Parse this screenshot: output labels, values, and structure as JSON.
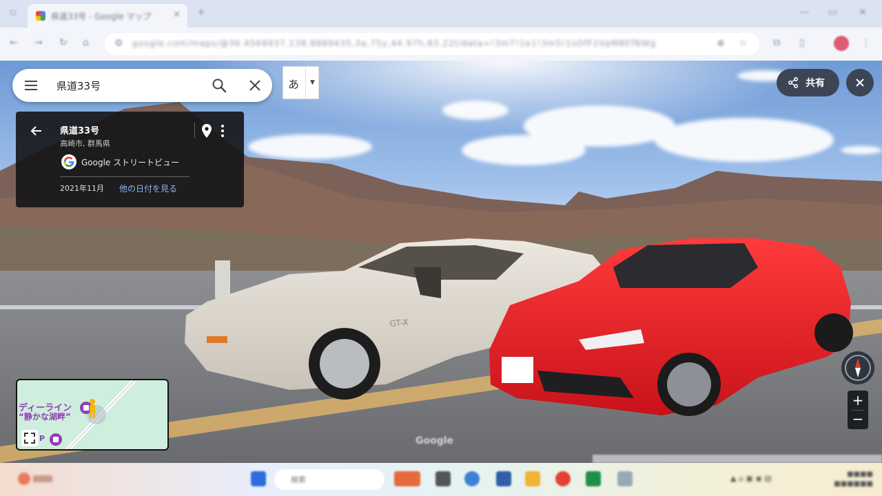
{
  "browser": {
    "tab_title": "県道33号 - Google マップ",
    "url": "google.com/maps/@36.4568937,138.8889435,3a,75y,44.97h,83.22t/data=!3m7!1e1!3m5!1sOfF2VpM8EfNWg"
  },
  "search": {
    "query": "県道33号"
  },
  "ime": {
    "mode_char": "あ"
  },
  "share": {
    "label": "共有"
  },
  "info_card": {
    "title": "県道33号",
    "subtitle": "高崎市, 群馬県",
    "provider": "Google ストリートビュー",
    "capture_date": "2021年11月",
    "other_dates_link": "他の日付を見る"
  },
  "minimap": {
    "place_line1": "ディーライン",
    "place_line2": "“静かな湖畔”",
    "poi_letter": "P"
  },
  "map_controls": {
    "zoom_in": "+",
    "zoom_out": "−"
  },
  "watermark": "Google",
  "taskbar": {
    "search_placeholder": "検索"
  },
  "colors": {
    "card_bg": "#141416",
    "link": "#8ab4f8",
    "control_bg": "#3c4555",
    "poi_purple": "#8e3fb8"
  }
}
